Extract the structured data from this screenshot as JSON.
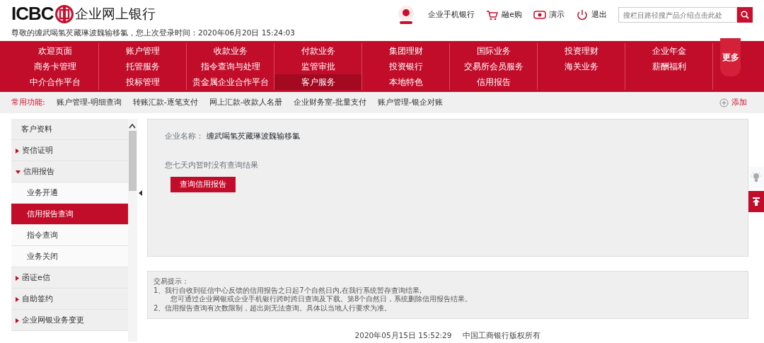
{
  "header": {
    "brand": "ICBC",
    "title": "企业网上银行",
    "welcome": "尊敬的缠武喝氢芡藏琳波魏输移氯，您上次登录时间：2020年06月20日 15:24:03",
    "links": [
      {
        "label": "企业手机银行",
        "kind": "none"
      },
      {
        "label": "融e购",
        "kind": "cart"
      },
      {
        "label": "演示",
        "kind": "eye"
      },
      {
        "label": "退出",
        "kind": "power"
      }
    ],
    "search": {
      "placeholder": "搜栏目路径搜产品介绍点击此处"
    }
  },
  "menu": {
    "rows": [
      [
        {
          "label": "欢迎页面",
          "selected": false
        },
        {
          "label": "账户管理",
          "selected": false
        },
        {
          "label": "收款业务",
          "selected": false
        },
        {
          "label": "付款业务",
          "selected": false
        },
        {
          "label": "集团理财",
          "selected": false
        },
        {
          "label": "国际业务",
          "selected": false
        },
        {
          "label": "投资理财",
          "selected": false
        },
        {
          "label": "企业年金",
          "selected": false
        }
      ],
      [
        {
          "label": "商务卡管理",
          "selected": false
        },
        {
          "label": "托管服务",
          "selected": false
        },
        {
          "label": "指令查询与处理",
          "selected": false
        },
        {
          "label": "监管审批",
          "selected": false
        },
        {
          "label": "投资银行",
          "selected": false
        },
        {
          "label": "交易所会员服务",
          "selected": false
        },
        {
          "label": "海关业务",
          "selected": false
        },
        {
          "label": "薪酬福利",
          "selected": false
        }
      ],
      [
        {
          "label": "中介合作平台",
          "selected": false
        },
        {
          "label": "投标管理",
          "selected": false
        },
        {
          "label": "贵金属企业合作平台",
          "selected": false
        },
        {
          "label": "客户服务",
          "selected": true
        },
        {
          "label": "本地特色",
          "selected": false
        },
        {
          "label": "信用报告",
          "selected": false
        }
      ]
    ],
    "more": "更多"
  },
  "quick": {
    "label": "常用功能:",
    "items": [
      "账户管理-明细查询",
      "转账汇款-逐笔支付",
      "网上汇款-收款人名册",
      "企业财务室-批量支付",
      "账户管理-银企对账"
    ],
    "add": "添加"
  },
  "sidebar": {
    "items": [
      {
        "label": "客户资料",
        "kind": "plain"
      },
      {
        "label": "资信证明",
        "kind": "group",
        "expanded": false
      },
      {
        "label": "信用报告",
        "kind": "group",
        "expanded": true,
        "children": [
          {
            "label": "业务开通",
            "selected": false
          },
          {
            "label": "信用报告查询",
            "selected": true
          },
          {
            "label": "指令查询",
            "selected": false
          },
          {
            "label": "业务关闭",
            "selected": false
          }
        ]
      },
      {
        "label": "函证e信",
        "kind": "group",
        "expanded": false
      },
      {
        "label": "自助签约",
        "kind": "group",
        "expanded": false
      },
      {
        "label": "企业网银业务变更",
        "kind": "group",
        "expanded": false
      }
    ]
  },
  "content": {
    "company_label": "企业名称：",
    "company_name": "缠武喝氢芡藏琳波魏输移氯",
    "empty_message": "您七天内暂时没有查询结果",
    "button": "查询信用报告"
  },
  "tips": {
    "title": "交易提示：",
    "lines": [
      "1、我行自收到征信中心反馈的信用报告之日起7个自然日内,在我行系统暂存查询结果,",
      "您可通过企业网银或企业手机银行跨时跨日查询及下载。第8个自然日，系统删除信用报告结果。",
      "2、信用报告查询有次数限制，超出则无法查询。具体以当地人行要求为准。"
    ]
  },
  "footer": {
    "time": "2020年05月15日 15:52:29",
    "copyright": "中国工商银行版权所有"
  }
}
